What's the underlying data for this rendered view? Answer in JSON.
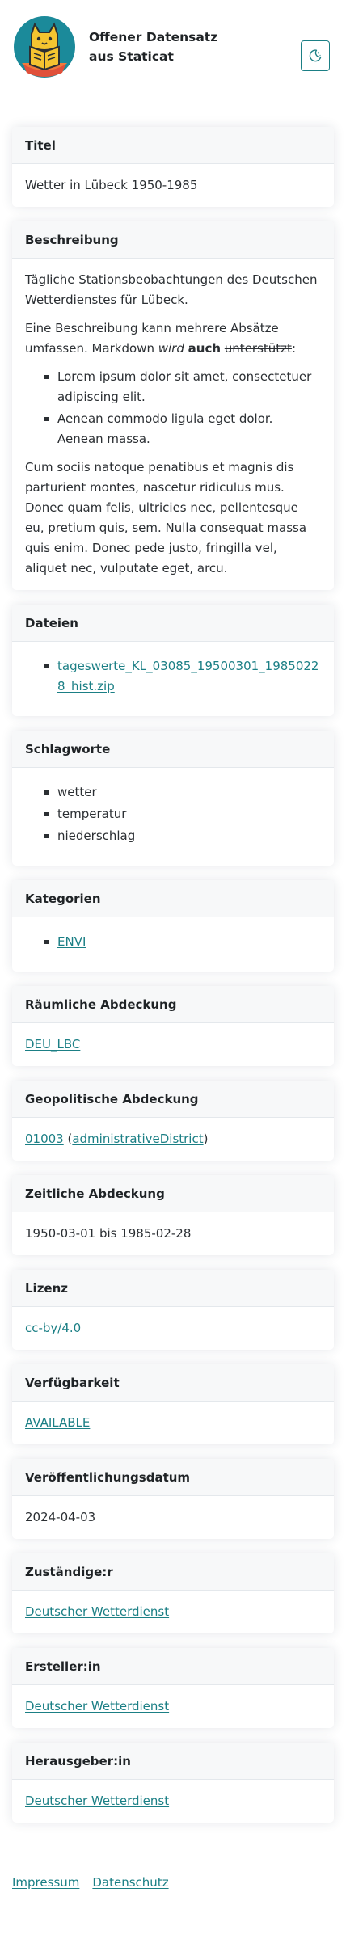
{
  "header": {
    "title_line1": "Offener Datensatz",
    "title_line2": "aus Staticat",
    "logo_icon": "cat-reading-book-logo-icon",
    "theme_toggle_icon": "moon-stars-icon"
  },
  "cards": {
    "titel": {
      "heading": "Titel",
      "value": "Wetter in Lübeck 1950-1985"
    },
    "beschreibung": {
      "heading": "Beschreibung",
      "p1": "Tägliche Stationsbeobachtungen des Deutschen Wetterdienstes für Lübeck.",
      "p2_start": "Eine Beschreibung kann mehrere Absätze umfassen. Markdown ",
      "p2_em": "wird",
      "p2_strong": "auch",
      "p2_del": "unterstützt",
      "p2_end": ":",
      "list": [
        "Lorem ipsum dolor sit amet, consectetuer adipiscing elit.",
        "Aenean commodo ligula eget dolor. Aenean massa."
      ],
      "p3": "Cum sociis natoque penatibus et magnis dis parturient montes, nascetur ridiculus mus. Donec quam felis, ultricies nec, pellentesque eu, pretium quis, sem. Nulla consequat massa quis enim. Donec pede justo, fringilla vel, aliquet nec, vulputate eget, arcu."
    },
    "dateien": {
      "heading": "Dateien",
      "files": [
        "tageswerte_KL_03085_19500301_19850228_hist.zip"
      ]
    },
    "schlagworte": {
      "heading": "Schlagworte",
      "items": [
        "wetter",
        "temperatur",
        "niederschlag"
      ]
    },
    "kategorien": {
      "heading": "Kategorien",
      "items": [
        "ENVI"
      ]
    },
    "raeumliche": {
      "heading": "Räumliche Abdeckung",
      "value": "DEU_LBC"
    },
    "geopolitische": {
      "heading": "Geopolitische Abdeckung",
      "code": "01003",
      "level": "administrativeDistrict",
      "open_paren": " (",
      "close_paren": ")"
    },
    "zeitliche": {
      "heading": "Zeitliche Abdeckung",
      "value": "1950-03-01 bis 1985-02-28"
    },
    "lizenz": {
      "heading": "Lizenz",
      "value": "cc-by/4.0"
    },
    "verfuegbarkeit": {
      "heading": "Verfügbarkeit",
      "value": "AVAILABLE"
    },
    "veroeffentlichung": {
      "heading": "Veröffentlichungsdatum",
      "value": "2024-04-03"
    },
    "zustaendig": {
      "heading": "Zuständige:r",
      "value": "Deutscher Wetterdienst"
    },
    "ersteller": {
      "heading": "Ersteller:in",
      "value": "Deutscher Wetterdienst"
    },
    "herausgeber": {
      "heading": "Herausgeber:in",
      "value": "Deutscher Wetterdienst"
    }
  },
  "footer": {
    "impressum": "Impressum",
    "datenschutz": "Datenschutz"
  },
  "colors": {
    "link": "#1b7f85",
    "logo_circle": "#1b8a9a",
    "logo_cat": "#f4c430"
  }
}
